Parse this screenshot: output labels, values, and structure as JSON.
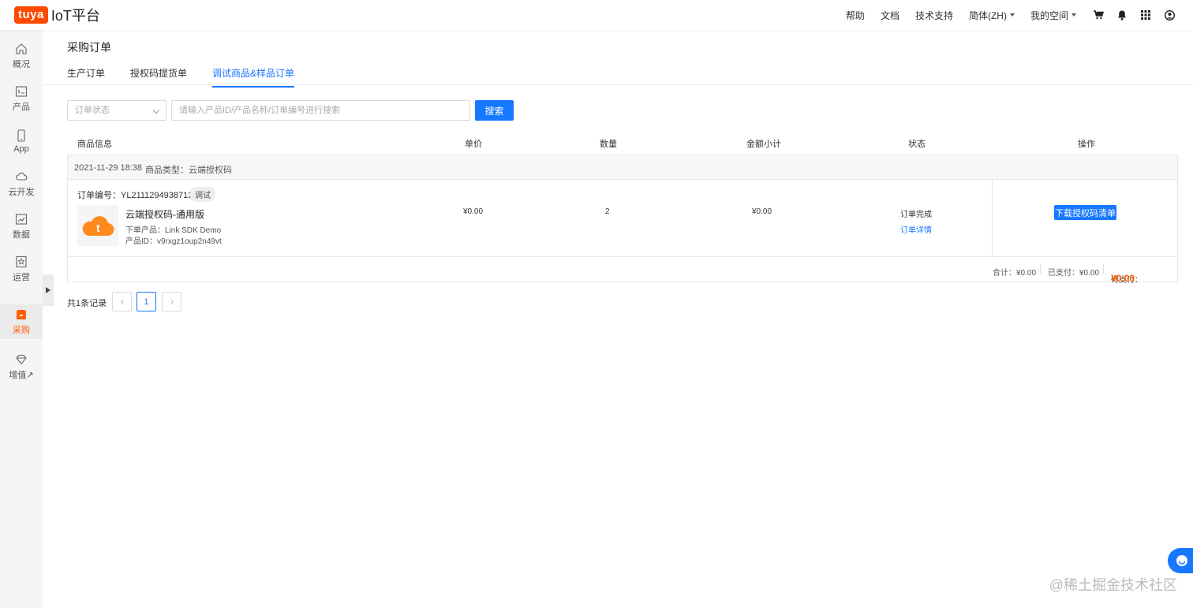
{
  "header": {
    "logo_badge": "tuya",
    "logo_text": "IoT平台",
    "nav": [
      "帮助",
      "文档",
      "技术支持"
    ],
    "language": "简体(ZH)",
    "workspace": "我的空间",
    "icons": [
      "cart-icon",
      "bell-icon",
      "grid-icon",
      "user-icon"
    ]
  },
  "sidebar": {
    "items": [
      {
        "label": "概况",
        "icon": "home-icon"
      },
      {
        "label": "产品",
        "icon": "terminal-icon"
      },
      {
        "label": "App",
        "icon": "phone-icon"
      },
      {
        "label": "云开发",
        "icon": "cloud-icon"
      },
      {
        "label": "数据",
        "icon": "chart-icon"
      },
      {
        "label": "运营",
        "icon": "star-box-icon"
      },
      {
        "label": "采购",
        "icon": "shop-icon",
        "active": true
      },
      {
        "label": "增值↗",
        "icon": "diamond-icon"
      }
    ]
  },
  "page": {
    "title": "采购订单",
    "tabs": [
      "生产订单",
      "授权码提货单",
      "调试商品&样品订单"
    ]
  },
  "filters": {
    "status_placeholder": "订单状态",
    "search_placeholder": "请输入产品ID/产品名称/订单编号进行搜索",
    "search_button": "搜索"
  },
  "table": {
    "headers": [
      "商品信息",
      "单价",
      "数量",
      "金额小计",
      "状态",
      "操作"
    ]
  },
  "order": {
    "datetime": "2021-11-29 18:38",
    "type": "商品类型：云端授权码",
    "number": "订单编号：YL2111294938713S",
    "tag": "调试",
    "product_name": "云端授权码-通用版",
    "ordered_product": "下单产品：Link SDK Demo",
    "product_id": "产品ID：v9rxgz1oup2n49vt",
    "unit_price": "¥0.00",
    "quantity": "2",
    "subtotal": "¥0.00",
    "status": "订单完成",
    "detail_link": "订单详情",
    "action_button": "下载授权码清单",
    "total": "合计：¥0.00",
    "paid": "已支付：¥0.00",
    "pending_label": "待支付：",
    "pending_value": "¥0.00"
  },
  "pagination": {
    "total": "共1条记录",
    "current": "1"
  },
  "watermark": "@稀土掘金技术社区",
  "colors": {
    "primary": "#1677ff",
    "brand": "#ff4800",
    "pending": "#ff5a00"
  }
}
